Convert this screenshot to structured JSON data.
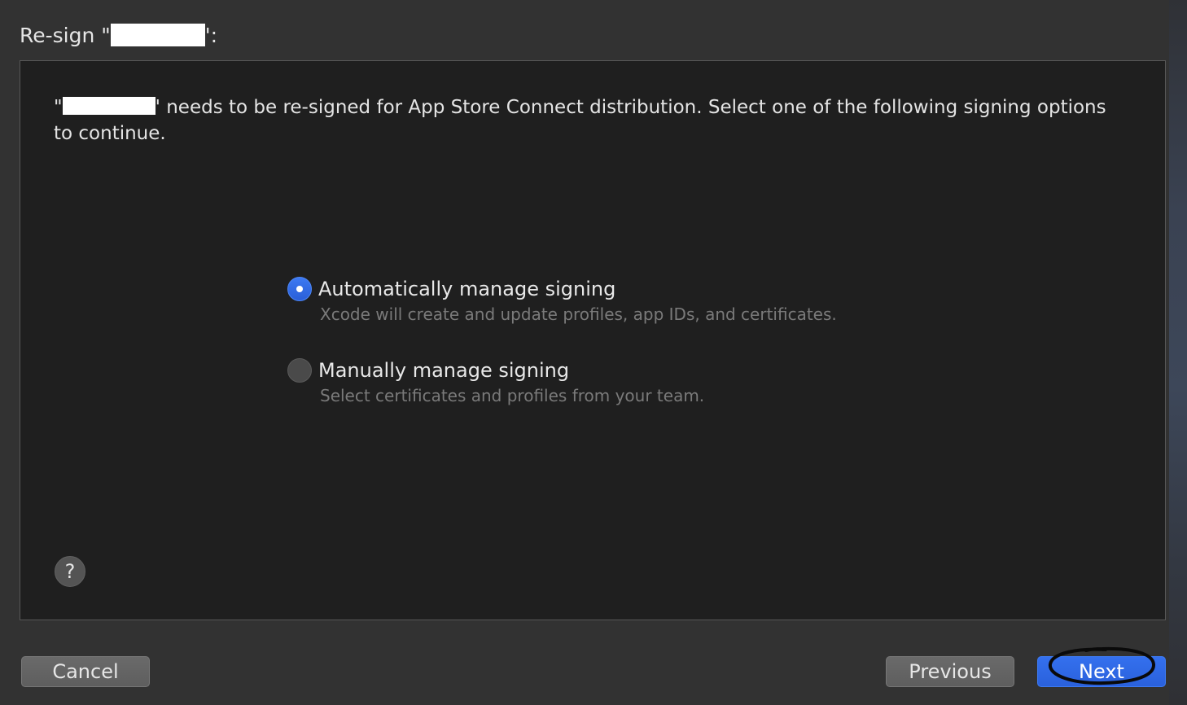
{
  "sheet": {
    "title_prefix": "Re-sign \"",
    "title_suffix": "':"
  },
  "message": {
    "prefix": "\"",
    "text": "' needs to be re-signed for App Store Connect distribution. Select one of the following signing options to continue."
  },
  "options": [
    {
      "label": "Automatically manage signing",
      "description": "Xcode will create and update profiles, app IDs, and certificates.",
      "selected": true
    },
    {
      "label": "Manually manage signing",
      "description": "Select certificates and profiles from your team.",
      "selected": false
    }
  ],
  "help": {
    "label": "?"
  },
  "buttons": {
    "cancel": "Cancel",
    "previous": "Previous",
    "next": "Next"
  },
  "colors": {
    "accent": "#2f6be6",
    "background": "#323232",
    "panel": "#1f1f1f"
  }
}
